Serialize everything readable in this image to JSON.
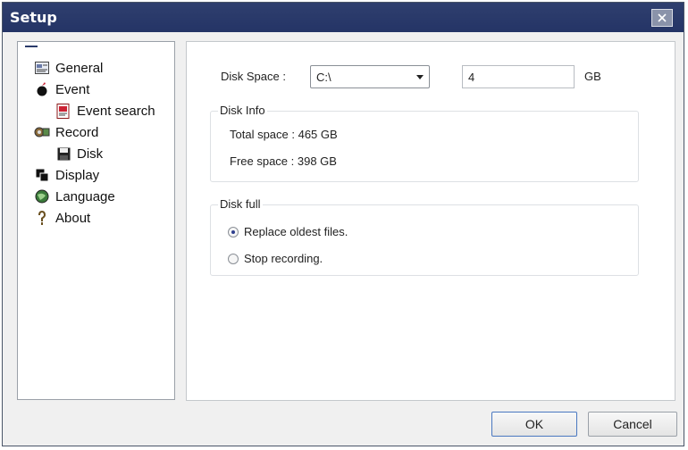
{
  "window": {
    "title": "Setup"
  },
  "nav": {
    "items": [
      {
        "label": "General",
        "icon": "general-icon"
      },
      {
        "label": "Event",
        "icon": "event-icon"
      },
      {
        "label": "Event search",
        "icon": "event-search-icon"
      },
      {
        "label": "Record",
        "icon": "record-icon"
      },
      {
        "label": "Disk",
        "icon": "disk-icon"
      },
      {
        "label": "Display",
        "icon": "display-icon"
      },
      {
        "label": "Language",
        "icon": "language-icon"
      },
      {
        "label": "About",
        "icon": "about-icon"
      }
    ],
    "selected": "Disk"
  },
  "disk": {
    "space_label": "Disk Space :",
    "drive_value": "C:\\",
    "size_value": "4",
    "size_unit": "GB"
  },
  "disk_info": {
    "legend": "Disk Info",
    "total": "Total space : 465 GB",
    "free": "Free space : 398 GB"
  },
  "disk_full": {
    "legend": "Disk full",
    "options": [
      "Replace oldest files.",
      "Stop recording."
    ],
    "selected_index": 0
  },
  "buttons": {
    "ok": "OK",
    "cancel": "Cancel"
  },
  "colors": {
    "titlebar": "#2f3f6e",
    "background": "#f0f0f0"
  }
}
